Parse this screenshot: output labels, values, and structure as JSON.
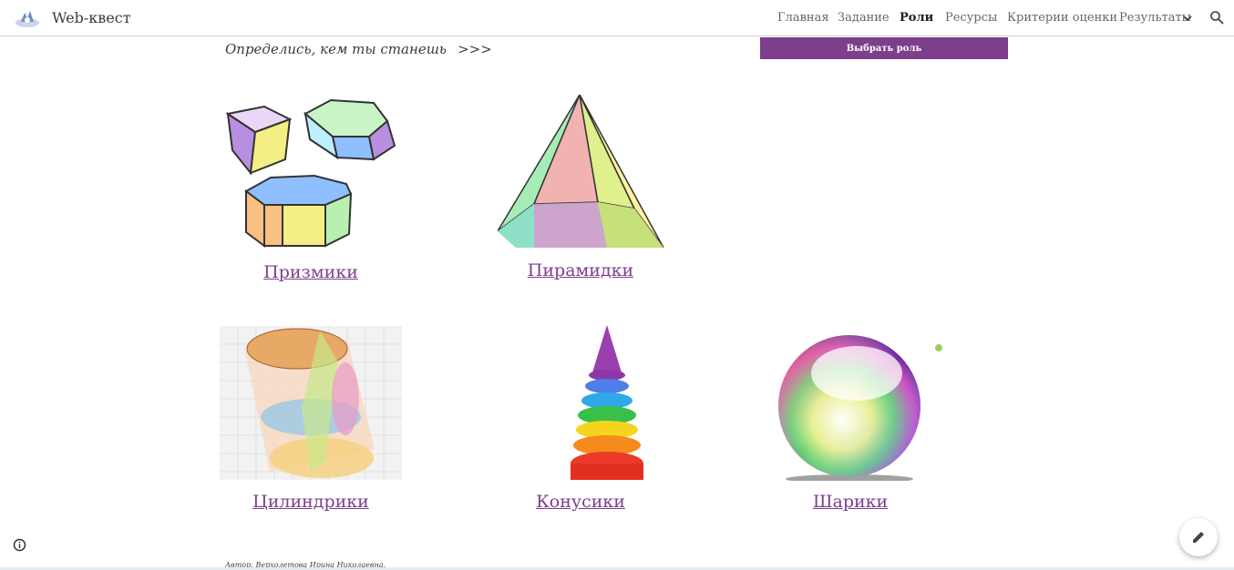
{
  "header": {
    "site_title": "Web-квест",
    "nav": [
      {
        "label": "Главная",
        "active": false
      },
      {
        "label": "Задание",
        "active": false
      },
      {
        "label": "Роли",
        "active": true
      },
      {
        "label": "Ресурсы",
        "active": false
      },
      {
        "label": "Критерии оценки",
        "active": false
      },
      {
        "label": "Результаты",
        "active": false
      }
    ],
    "icons": [
      "site-logo-icon",
      "chevron-down-icon",
      "search-icon"
    ]
  },
  "intro": {
    "text": "Определись, кем ты станешь",
    "arrows": ">>>",
    "button_label": "Выбрать роль"
  },
  "cards": [
    {
      "label": "Призмики"
    },
    {
      "label": "Пирамидки"
    },
    {
      "label": "Цилиндрики"
    },
    {
      "label": "Конусики"
    },
    {
      "label": "Шарики"
    }
  ],
  "footer": {
    "author": "Автор: Верхолетова Ирина Николаевна."
  },
  "colors": {
    "accent": "#7d3e8c",
    "link": "#7d3e8c"
  }
}
